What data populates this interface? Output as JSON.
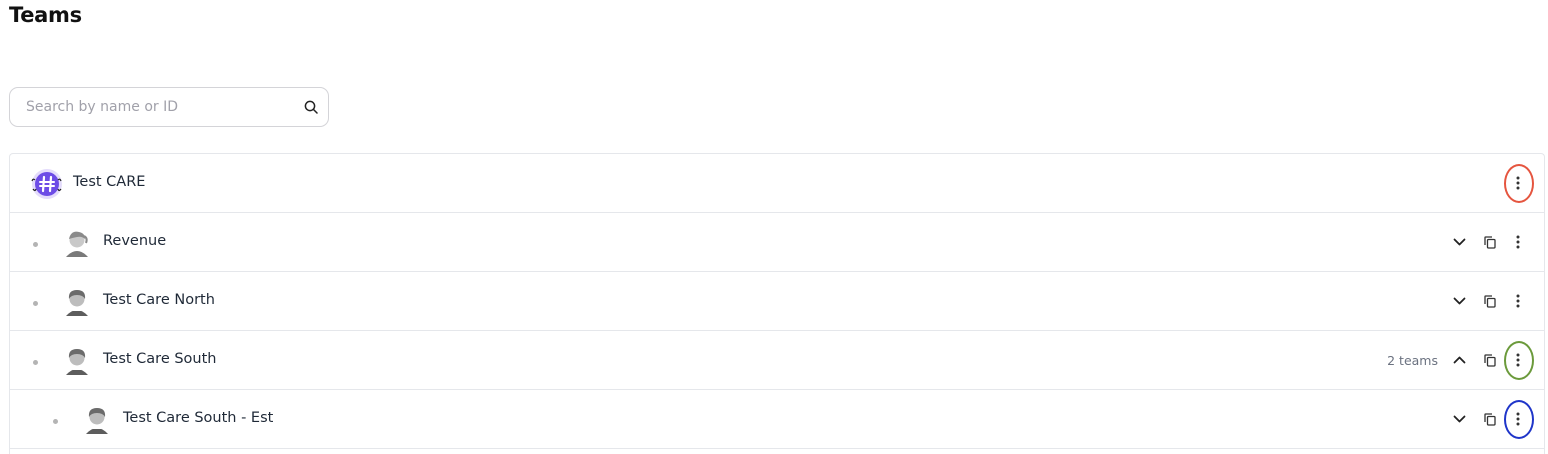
{
  "page": {
    "title": "Teams"
  },
  "search": {
    "placeholder": "Search by name or ID",
    "value": "",
    "icon": "search-icon"
  },
  "org": {
    "name": "Test CARE",
    "icon": "organization-logo",
    "accent": "#6d4ce6"
  },
  "teams": [
    {
      "name": "Revenue",
      "count": "",
      "expanded": false,
      "depth": 1
    },
    {
      "name": "Test Care North",
      "count": "",
      "expanded": false,
      "depth": 1
    },
    {
      "name": "Test Care South",
      "count": "2 teams",
      "expanded": true,
      "depth": 1
    },
    {
      "name": "Test Care South - Est",
      "count": "",
      "expanded": false,
      "depth": 2
    }
  ],
  "highlights": {
    "org_menu": "#e5553f",
    "team_menu": "#6b9a3b",
    "subteam_menu": "#1f35c9"
  }
}
